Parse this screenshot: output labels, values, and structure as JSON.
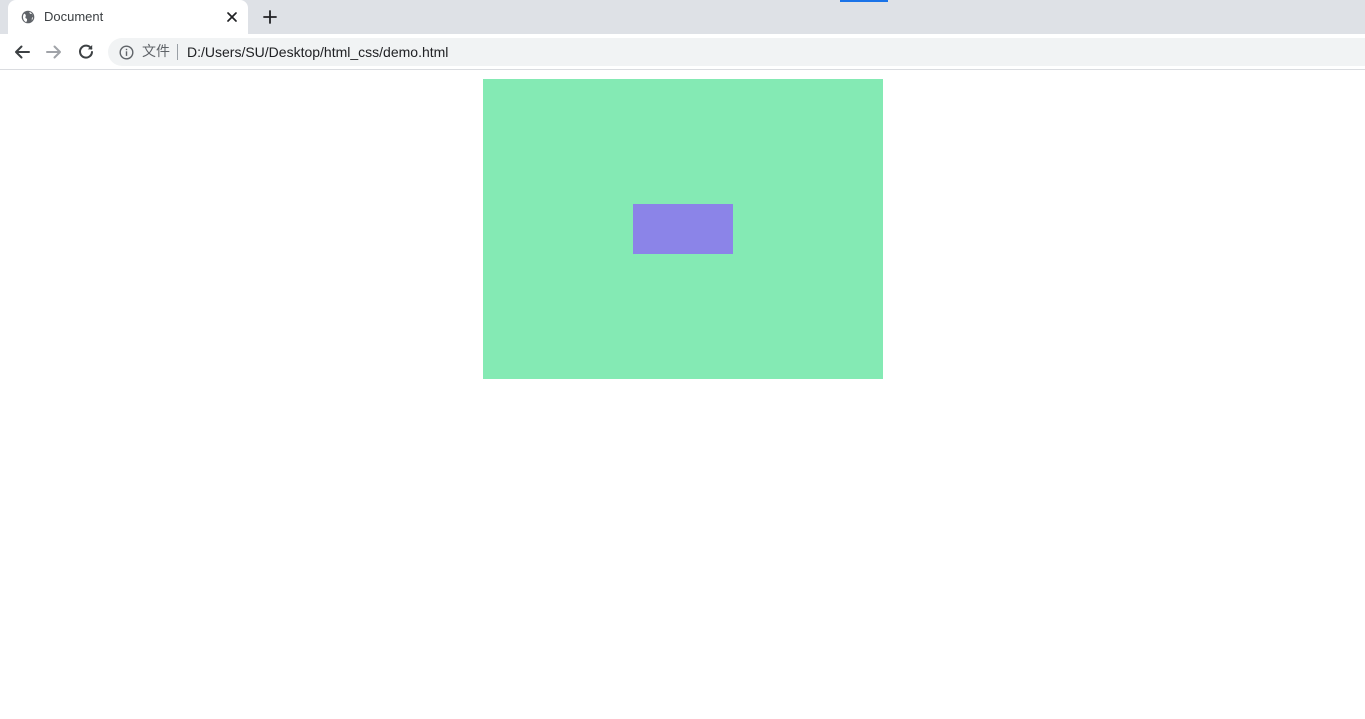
{
  "browser": {
    "tab": {
      "title": "Document",
      "favicon": "globe-icon",
      "close_icon": "close-icon"
    },
    "new_tab_icon": "plus-icon",
    "nav": {
      "back_icon": "arrow-left-icon",
      "forward_icon": "arrow-right-icon",
      "reload_icon": "reload-icon"
    },
    "omnibox": {
      "site_info_icon": "info-icon",
      "scheme_label": "文件",
      "url": "D:/Users/SU/Desktop/html_css/demo.html"
    }
  },
  "page": {
    "outer_box": {
      "color": "#84eab4"
    },
    "inner_box": {
      "color": "#8b84e8"
    }
  }
}
